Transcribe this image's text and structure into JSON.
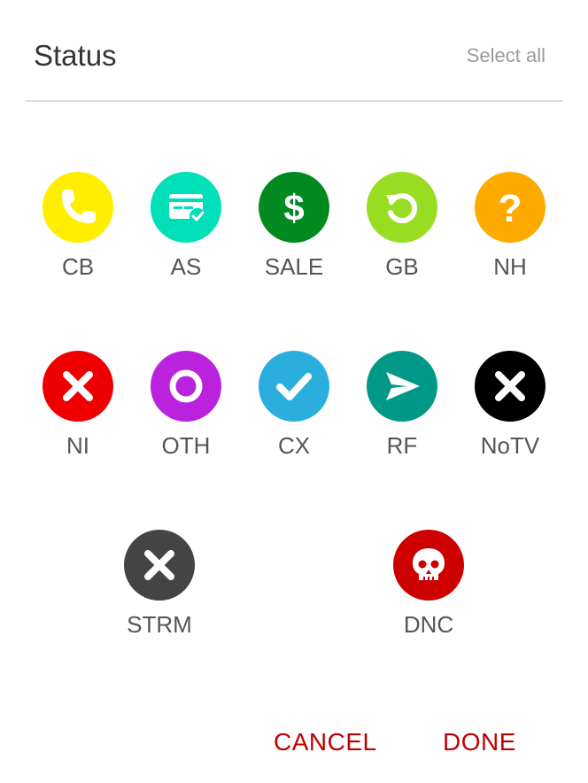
{
  "header": {
    "title": "Status",
    "select_all_label": "Select all"
  },
  "statuses": [
    {
      "code": "CB",
      "icon": "phone-icon",
      "color": "#ffee00"
    },
    {
      "code": "AS",
      "icon": "credit-card-check-icon",
      "color": "#00e0b8"
    },
    {
      "code": "SALE",
      "icon": "dollar-icon",
      "color": "#008a1f"
    },
    {
      "code": "GB",
      "icon": "refresh-icon",
      "color": "#99dd22"
    },
    {
      "code": "NH",
      "icon": "question-icon",
      "color": "#ffaa00"
    },
    {
      "code": "NI",
      "icon": "close-icon",
      "color": "#ee0000"
    },
    {
      "code": "OTH",
      "icon": "ring-icon",
      "color": "#bb22dd"
    },
    {
      "code": "CX",
      "icon": "check-icon",
      "color": "#2aaedd"
    },
    {
      "code": "RF",
      "icon": "send-icon",
      "color": "#009988"
    },
    {
      "code": "NoTV",
      "icon": "close-icon",
      "color": "#000000"
    },
    {
      "code": "STRM",
      "icon": "close-icon",
      "color": "#444444"
    },
    {
      "code": "DNC",
      "icon": "skull-icon",
      "color": "#cc0000"
    }
  ],
  "actions": {
    "cancel_label": "CANCEL",
    "done_label": "DONE"
  }
}
